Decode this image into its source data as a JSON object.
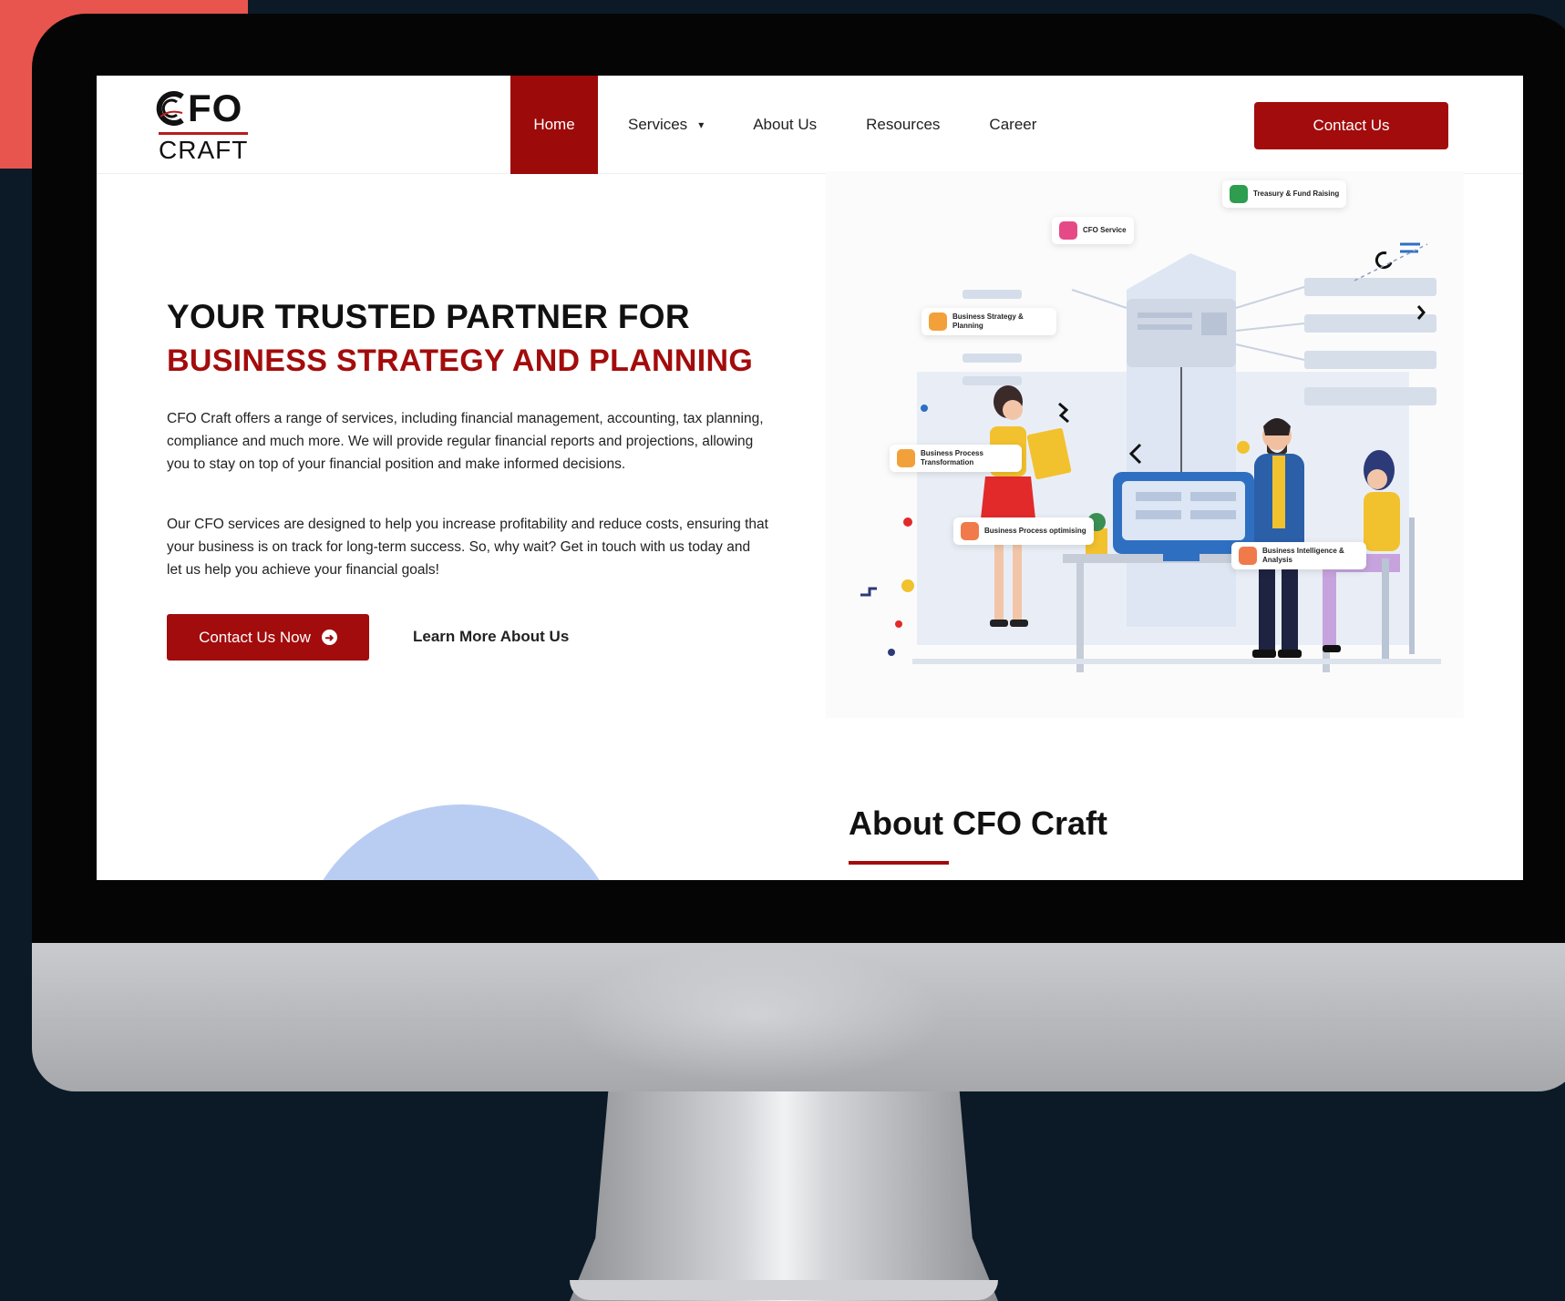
{
  "brand": {
    "logo_top": "FO",
    "logo_bottom": "CRAFT"
  },
  "nav": {
    "items": [
      {
        "label": "Home",
        "active": true
      },
      {
        "label": "Services",
        "has_dropdown": true
      },
      {
        "label": "About Us"
      },
      {
        "label": "Resources"
      },
      {
        "label": "Career"
      }
    ],
    "chevron": "▾",
    "cta": "Contact Us"
  },
  "hero": {
    "title_line1": "YOUR TRUSTED PARTNER FOR",
    "title_line2": "BUSINESS STRATEGY AND PLANNING",
    "paragraph1": "CFO Craft offers a range of services, including financial management, accounting, tax planning, compliance and much more. We will provide regular financial reports and projections, allowing you to stay on top of your financial position and make informed decisions.",
    "paragraph2": "Our CFO services are designed to help you increase profitability and reduce costs, ensuring that your business is on track for long-term success. So, why wait? Get in touch with us today and let us help you achieve your financial goals!",
    "primary_button": "Contact Us Now",
    "secondary_link": "Learn More About Us"
  },
  "illustration": {
    "cards": [
      {
        "label": "Treasury & Fund Raising",
        "color": "#2e9d4e"
      },
      {
        "label": "CFO Service",
        "color": "#e64a86"
      },
      {
        "label": "Business Strategy & Planning",
        "color": "#f2a13a"
      },
      {
        "label": "Business Process Transformation",
        "color": "#f2a13a"
      },
      {
        "label": "Business Process optimising",
        "color": "#f07a4a"
      },
      {
        "label": "Business Intelligence & Analysis",
        "color": "#f07a4a"
      }
    ]
  },
  "about": {
    "title": "About CFO Craft"
  },
  "colors": {
    "brand_red": "#a30c0c",
    "background": "#0b1a26",
    "accent_corner": "#e8554f"
  }
}
